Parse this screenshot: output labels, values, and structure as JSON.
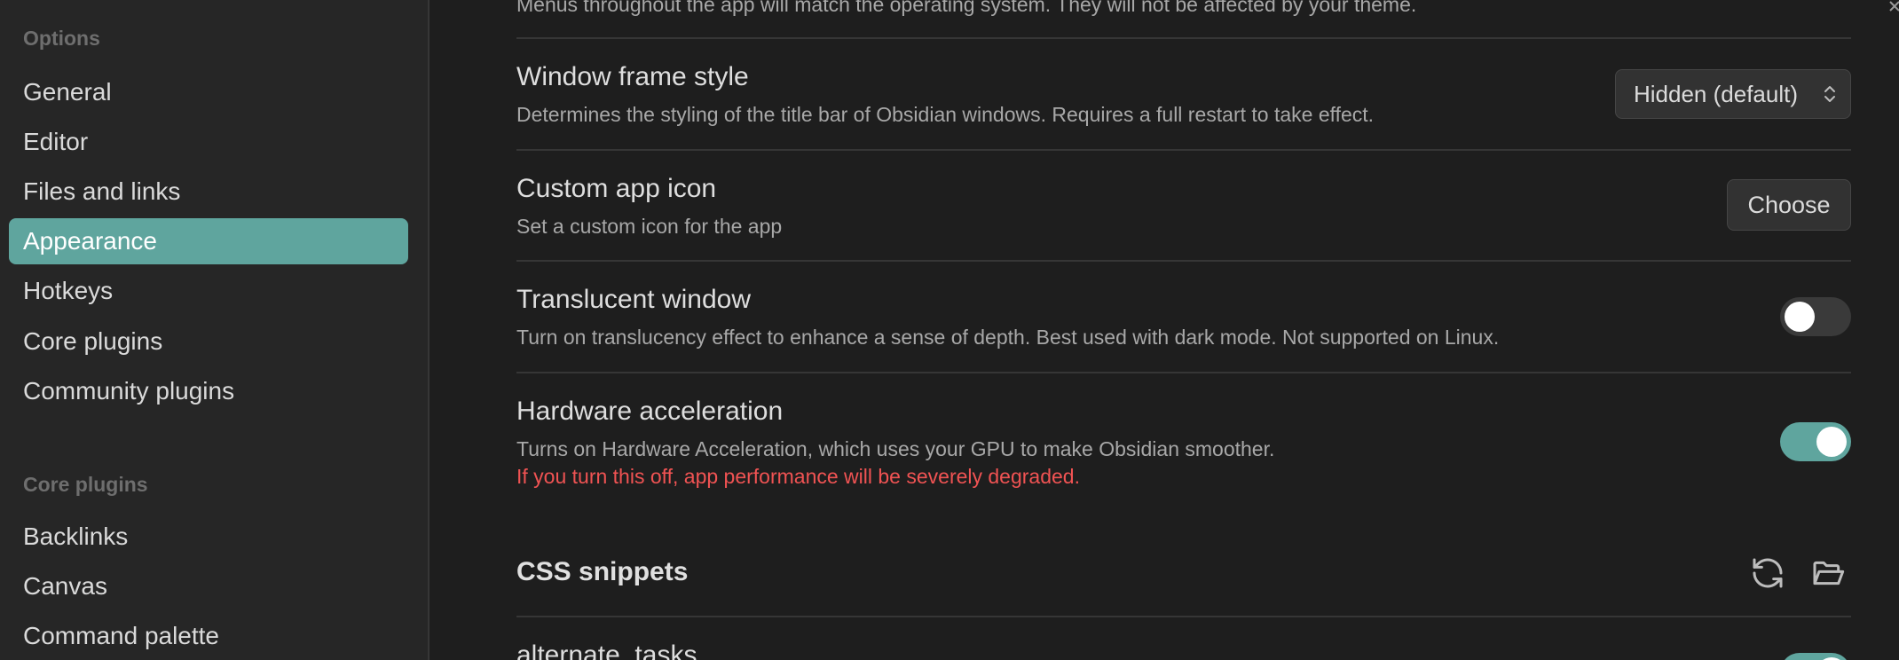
{
  "sidebar": {
    "options_title": "Options",
    "options_items": [
      {
        "label": "General"
      },
      {
        "label": "Editor"
      },
      {
        "label": "Files and links"
      },
      {
        "label": "Appearance"
      },
      {
        "label": "Hotkeys"
      },
      {
        "label": "Core plugins"
      },
      {
        "label": "Community plugins"
      }
    ],
    "core_title": "Core plugins",
    "core_items": [
      {
        "label": "Backlinks"
      },
      {
        "label": "Canvas"
      },
      {
        "label": "Command palette"
      }
    ]
  },
  "main": {
    "native_menus_desc": "Menus throughout the app will match the operating system. They will not be affected by your theme.",
    "window_frame": {
      "title": "Window frame style",
      "desc": "Determines the styling of the title bar of Obsidian windows. Requires a full restart to take effect.",
      "value": "Hidden (default)"
    },
    "custom_icon": {
      "title": "Custom app icon",
      "desc": "Set a custom icon for the app",
      "button": "Choose"
    },
    "translucent": {
      "title": "Translucent window",
      "desc": "Turn on translucency effect to enhance a sense of depth. Best used with dark mode. Not supported on Linux.",
      "state": "off"
    },
    "hardware": {
      "title": "Hardware acceleration",
      "desc": "Turns on Hardware Acceleration, which uses your GPU to make Obsidian smoother.",
      "warning": "If you turn this off, app performance will be severely degraded.",
      "state": "on"
    },
    "css_snippets": {
      "title": "CSS snippets",
      "reload_icon": "reload-icon",
      "folder_icon": "folder-open-icon"
    },
    "snippet_row": {
      "title": "alternate_tasks",
      "state": "on"
    }
  },
  "colors": {
    "accent": "#5fa59e",
    "warning": "#f05353",
    "background": "#1e1e1e",
    "sidebar": "#262626"
  }
}
